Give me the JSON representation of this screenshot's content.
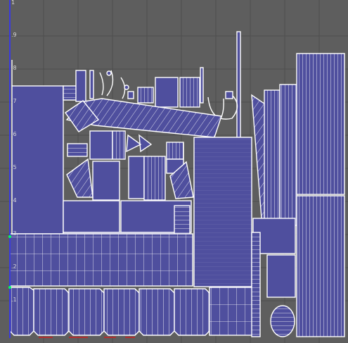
{
  "editor": {
    "colors": {
      "background": "#5e5e5e",
      "grid": "#4e4e4e",
      "island_fill": "#4f4f9e",
      "island_edge": "#ffffff",
      "v_axis": "#3a3adf",
      "u_axis": "#b03030",
      "selected_vertex": "#00ff66"
    },
    "v_ticks": [
      "1",
      ".9",
      ".8",
      ".7",
      ".6",
      ".5",
      ".4",
      ".3",
      ".2",
      ".1"
    ]
  }
}
